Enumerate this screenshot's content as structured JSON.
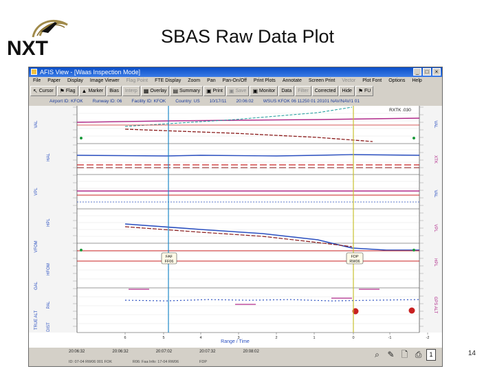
{
  "slide": {
    "title": "SBAS Raw Data Plot",
    "page_number": "14",
    "logo_text": "NXT"
  },
  "window": {
    "title": "AFIS View - [Waas Inspection Mode]",
    "controls": [
      "_",
      "□",
      "×"
    ],
    "menu": [
      {
        "label": "File",
        "dim": false
      },
      {
        "label": "Paper",
        "dim": false
      },
      {
        "label": "Display",
        "dim": false
      },
      {
        "label": "Image Viewer",
        "dim": false
      },
      {
        "label": "Flag Point",
        "dim": true
      },
      {
        "label": "FTE Display",
        "dim": false
      },
      {
        "label": "Zoom",
        "dim": false
      },
      {
        "label": "Pan",
        "dim": false
      },
      {
        "label": "Pan-On/Off",
        "dim": false
      },
      {
        "label": "Print Plots",
        "dim": false
      },
      {
        "label": "Annotate",
        "dim": false
      },
      {
        "label": "Screen Print",
        "dim": false
      },
      {
        "label": "Vector",
        "dim": true
      },
      {
        "label": "Plot Font",
        "dim": false
      },
      {
        "label": "Options",
        "dim": false
      },
      {
        "label": "Help",
        "dim": false
      }
    ]
  },
  "toolbar": [
    {
      "label": "Cursor",
      "icon": "↖",
      "dim": false
    },
    {
      "label": "Flag",
      "icon": "⚑",
      "dim": false
    },
    {
      "label": "Marker",
      "icon": "▲",
      "dim": false
    },
    {
      "label": "Bias",
      "icon": "",
      "dim": false
    },
    {
      "label": "Interp",
      "icon": "",
      "dim": true
    },
    {
      "label": "Overlay",
      "icon": "▦",
      "dim": false
    },
    {
      "label": "Summary",
      "icon": "▤",
      "dim": false
    },
    {
      "label": "Print",
      "icon": "▣",
      "dim": false
    },
    {
      "label": "Save",
      "icon": "▣",
      "dim": true
    },
    {
      "label": "Monitor",
      "icon": "▣",
      "dim": false
    },
    {
      "label": "Data",
      "icon": "",
      "dim": false
    },
    {
      "label": "Filter",
      "icon": "",
      "dim": true
    },
    {
      "label": "Corrected",
      "icon": "",
      "dim": false
    },
    {
      "label": "Hide",
      "icon": "",
      "dim": false
    },
    {
      "label": "FU",
      "icon": "⚑",
      "dim": false
    }
  ],
  "info": {
    "airport": "Airport ID: KFOK",
    "runway": "Runway ID: 06",
    "facility": "Facility ID: KFOK",
    "country": "Country: US",
    "date": "10/17/11",
    "time": "20:06:02",
    "procedure": "WSUS KFOK 06 11250 01 20101 NAV/NAV/1 01"
  },
  "plot": {
    "xlabel": "Range / Time",
    "annotations": {
      "top": "RXTK .030",
      "faf": [
        "FAF",
        "FF06"
      ],
      "fdp": [
        "FDP",
        "RW06"
      ]
    },
    "left_labels": [
      {
        "name": "VAL",
        "color": "#2a4fc0"
      },
      {
        "name": "HAL",
        "color": "#2a4fc0"
      },
      {
        "name": "VPL",
        "color": "#2a4fc0"
      },
      {
        "name": "HPL",
        "color": "#2a4fc0"
      },
      {
        "name": "VFOM",
        "color": "#2a4fc0"
      },
      {
        "name": "HFOM",
        "color": "#2a4fc0"
      },
      {
        "name": "GAL",
        "color": "#2a4fc0"
      },
      {
        "name": "PAL",
        "color": "#2a4fc0"
      },
      {
        "name": "TRUE ALT",
        "color": "#2a4fc0"
      },
      {
        "name": "DIST",
        "color": "#2a4fc0"
      }
    ],
    "right_labels": [
      {
        "name": "VAL",
        "color": "#2a4fc0"
      },
      {
        "name": "XTK",
        "color": "#b02a8a"
      },
      {
        "name": "VAL",
        "color": "#2a4fc0"
      },
      {
        "name": "VPL",
        "color": "#b02a8a"
      },
      {
        "name": "HPL",
        "color": "#b02a8a"
      },
      {
        "name": "GPS ALT",
        "color": "#b02a8a"
      }
    ],
    "x_ticks": [
      "6",
      "5",
      "4",
      "3",
      "2",
      "1",
      "0",
      "-1",
      "-2"
    ],
    "time_ticks": [
      "20:06:32",
      "20:06:32",
      "20:07:02",
      "20:07:32",
      "20:08:02",
      "20:08:02"
    ],
    "colors": {
      "blue": "#2a4fc0",
      "red": "#c82020",
      "magenta": "#b02a8a",
      "green": "#1a9a3a",
      "teal": "#1a9a9a",
      "darkred": "#8a1a1a"
    }
  },
  "status": {
    "row1": [
      "20:06:32",
      "20:06:32",
      "20:07:02",
      "20:07:32",
      "20:08:02"
    ],
    "row2": [
      "ID: 07-04 RW06 001 FOK",
      "R06: Faa Info: 17-04 RW06",
      "FDP"
    ],
    "tools": [
      "search-icon",
      "pencil-icon",
      "page-icon",
      "print-icon"
    ],
    "spin_value": "1"
  }
}
